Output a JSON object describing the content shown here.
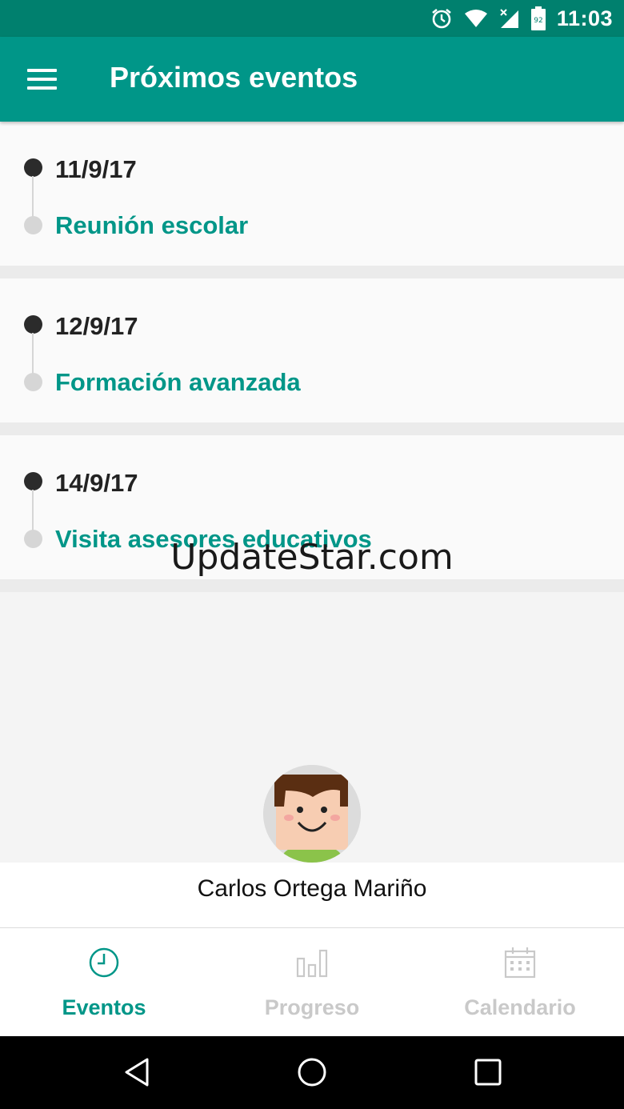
{
  "status_bar": {
    "time": "11:03",
    "battery_level": "92",
    "icons": [
      "alarm-icon",
      "wifi-icon",
      "signal-icon",
      "battery-icon"
    ]
  },
  "app_bar": {
    "title": "Próximos eventos",
    "menu_icon": "hamburger-menu-icon"
  },
  "events": [
    {
      "date": "11/9/17",
      "title": "Reunión escolar"
    },
    {
      "date": "12/9/17",
      "title": "Formación avanzada"
    },
    {
      "date": "14/9/17",
      "title": "Visita asesores educativos"
    }
  ],
  "watermark": "UpdateStar.com",
  "profile": {
    "name": "Carlos Ortega Mariño",
    "avatar_icon": "boy-avatar-icon"
  },
  "bottom_nav": [
    {
      "label": "Eventos",
      "icon": "clock-icon",
      "active": true
    },
    {
      "label": "Progreso",
      "icon": "bar-chart-icon",
      "active": false
    },
    {
      "label": "Calendario",
      "icon": "calendar-icon",
      "active": false
    }
  ],
  "colors": {
    "primary": "#009688",
    "primary_dark": "#00806e",
    "inactive": "#c9c9c9"
  }
}
